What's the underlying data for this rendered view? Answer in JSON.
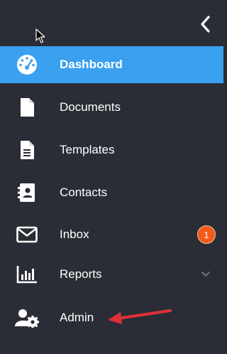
{
  "sidebar": {
    "collapse_icon": "chevron-left-icon",
    "items": [
      {
        "label": "Dashboard",
        "icon": "dashboard-gauge-icon",
        "active": true
      },
      {
        "label": "Documents",
        "icon": "document-icon"
      },
      {
        "label": "Templates",
        "icon": "template-icon"
      },
      {
        "label": "Contacts",
        "icon": "contacts-book-icon"
      },
      {
        "label": "Inbox",
        "icon": "envelope-icon",
        "badge": "1"
      },
      {
        "label": "Reports",
        "icon": "bar-chart-icon",
        "expand_icon": "chevron-down-icon"
      },
      {
        "label": "Admin",
        "icon": "user-gear-icon"
      }
    ]
  },
  "colors": {
    "background": "#2a2d35",
    "active_item": "#3aa0f0",
    "badge": "#f35a1c",
    "annotation_arrow": "#e0303a"
  }
}
